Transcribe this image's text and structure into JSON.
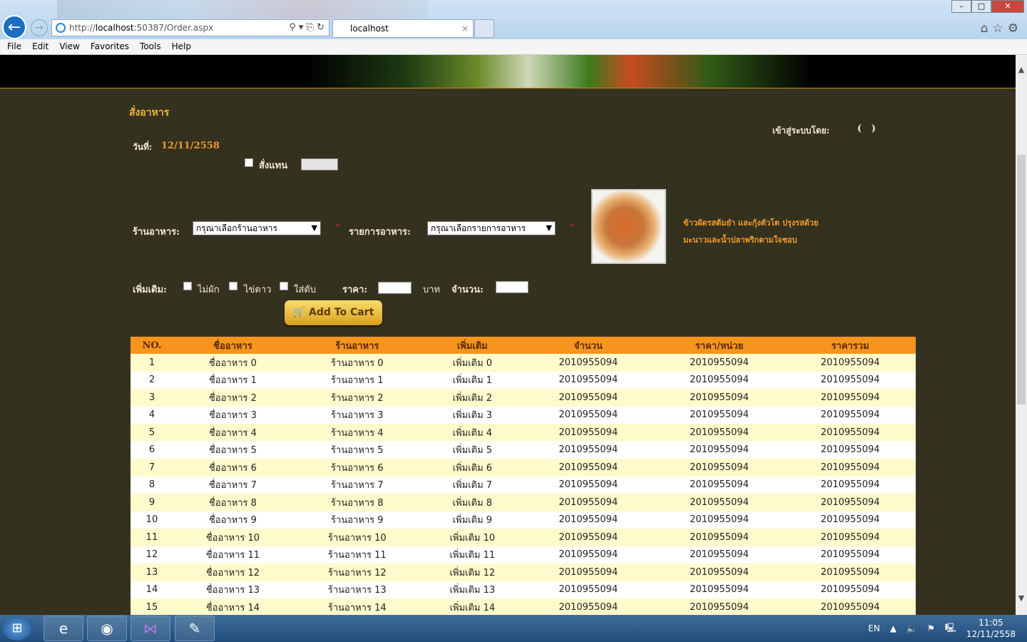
{
  "browser": {
    "url_prefix": "http://",
    "url_host": "localhost",
    "url_rest": ":50387/Order.aspx",
    "tab_title": "localhost",
    "tab_close": "×",
    "window_min": "–",
    "window_max": "□",
    "window_close": "✕",
    "addr_tools": "⚲ ▾ ⎘ ↻",
    "right_tools": "⌂☆⚙"
  },
  "menu": [
    "File",
    "Edit",
    "View",
    "Favorites",
    "Tools",
    "Help"
  ],
  "page": {
    "title": "สั่งอาหาร",
    "login_label": "เข้าสู่ระบบโดย:",
    "login_value": "(   )",
    "date_label": "วันที่:",
    "date_value": "12/11/2558",
    "order_for_label": "สั่งแทน",
    "restaurant_label": "ร้านอาหาร:",
    "restaurant_select": "กรุณาเลือกร้านอาหาร",
    "menu_label": "รายการอาหาร:",
    "menu_select": "กรุณาเลือกรายการอาหาร",
    "required_mark": "*",
    "food_desc_1": "ข้าวผัดรสต้มยำ และกุ้งตัวโต ปรุงรสด้วย",
    "food_desc_2": "มะนาวและน้ำปลาพริกตามใจชอบ",
    "extra_label": "เพิ่มเติม:",
    "extras": [
      "ไม่ผัก",
      "ไข่ดาว",
      "ใส่ตับ"
    ],
    "price_label": "ราคา:",
    "baht": "บาท",
    "qty_label": "จำนวน:",
    "add_to_cart": "Add To Cart"
  },
  "table": {
    "headers": [
      "NO.",
      "ชื่ออาหาร",
      "ร้านอาหาร",
      "เพิ่มเติม",
      "จำนวน",
      "ราคา/หน่วย",
      "ราคารวม"
    ],
    "rows": [
      [
        "1",
        "ชื่ออาหาร 0",
        "ร้านอาหาร 0",
        "เพิ่มเติม 0",
        "2010955094",
        "2010955094",
        "2010955094"
      ],
      [
        "2",
        "ชื่ออาหาร 1",
        "ร้านอาหาร 1",
        "เพิ่มเติม 1",
        "2010955094",
        "2010955094",
        "2010955094"
      ],
      [
        "3",
        "ชื่ออาหาร 2",
        "ร้านอาหาร 2",
        "เพิ่มเติม 2",
        "2010955094",
        "2010955094",
        "2010955094"
      ],
      [
        "4",
        "ชื่ออาหาร 3",
        "ร้านอาหาร 3",
        "เพิ่มเติม 3",
        "2010955094",
        "2010955094",
        "2010955094"
      ],
      [
        "5",
        "ชื่ออาหาร 4",
        "ร้านอาหาร 4",
        "เพิ่มเติม 4",
        "2010955094",
        "2010955094",
        "2010955094"
      ],
      [
        "6",
        "ชื่ออาหาร 5",
        "ร้านอาหาร 5",
        "เพิ่มเติม 5",
        "2010955094",
        "2010955094",
        "2010955094"
      ],
      [
        "7",
        "ชื่ออาหาร 6",
        "ร้านอาหาร 6",
        "เพิ่มเติม 6",
        "2010955094",
        "2010955094",
        "2010955094"
      ],
      [
        "8",
        "ชื่ออาหาร 7",
        "ร้านอาหาร 7",
        "เพิ่มเติม 7",
        "2010955094",
        "2010955094",
        "2010955094"
      ],
      [
        "9",
        "ชื่ออาหาร 8",
        "ร้านอาหาร 8",
        "เพิ่มเติม 8",
        "2010955094",
        "2010955094",
        "2010955094"
      ],
      [
        "10",
        "ชื่ออาหาร 9",
        "ร้านอาหาร 9",
        "เพิ่มเติม 9",
        "2010955094",
        "2010955094",
        "2010955094"
      ],
      [
        "11",
        "ชื่ออาหาร 10",
        "ร้านอาหาร 10",
        "เพิ่มเติม 10",
        "2010955094",
        "2010955094",
        "2010955094"
      ],
      [
        "12",
        "ชื่ออาหาร 11",
        "ร้านอาหาร 11",
        "เพิ่มเติม 11",
        "2010955094",
        "2010955094",
        "2010955094"
      ],
      [
        "13",
        "ชื่ออาหาร 12",
        "ร้านอาหาร 12",
        "เพิ่มเติม 12",
        "2010955094",
        "2010955094",
        "2010955094"
      ],
      [
        "14",
        "ชื่ออาหาร 13",
        "ร้านอาหาร 13",
        "เพิ่มเติม 13",
        "2010955094",
        "2010955094",
        "2010955094"
      ],
      [
        "15",
        "ชื่ออาหาร 14",
        "ร้านอาหาร 14",
        "เพิ่มเติม 14",
        "2010955094",
        "2010955094",
        "2010955094"
      ]
    ]
  },
  "taskbar": {
    "lang": "EN",
    "time": "11:05",
    "date": "12/11/2558"
  }
}
